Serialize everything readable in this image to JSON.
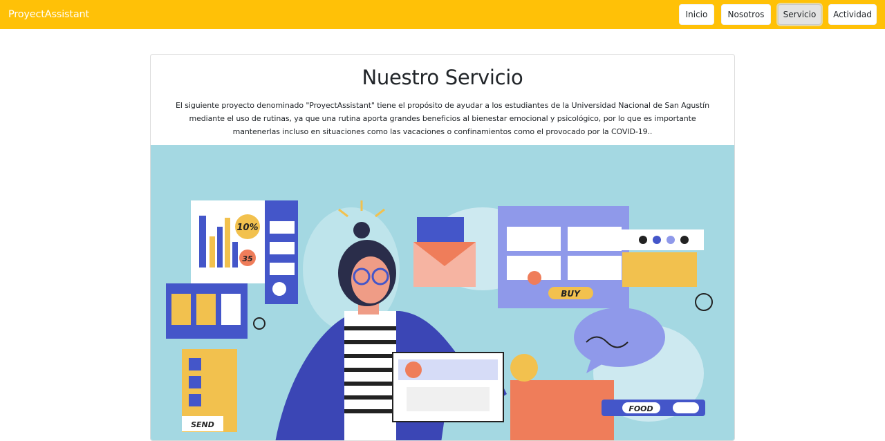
{
  "navbar": {
    "brand": "ProyectAssistant",
    "links": [
      {
        "label": "Inicio",
        "active": false
      },
      {
        "label": "Nosotros",
        "active": false
      },
      {
        "label": "Servicio",
        "active": true
      },
      {
        "label": "Actividad",
        "active": false
      }
    ],
    "color": "#ffc107"
  },
  "card": {
    "title": "Nuestro Servicio",
    "text": "El siguiente proyecto denominado \"ProyectAssistant\" tiene el propósito de ayudar a los estudiantes de la Universidad Nacional de San Agustín mediante el uso de rutinas, ya que una rutina aporta grandes beneficios al bienestar emocional y psicológico, por lo que es importante mantenerlas incluso en situaciones como las vacaciones o confinamientos como el provocado por la COVID-19..",
    "illustration": {
      "background": "#a4d8e2",
      "labels": {
        "percent": "10%",
        "number": "35",
        "buy": "BUY",
        "food": "FOOD",
        "send": "SEND"
      }
    }
  }
}
